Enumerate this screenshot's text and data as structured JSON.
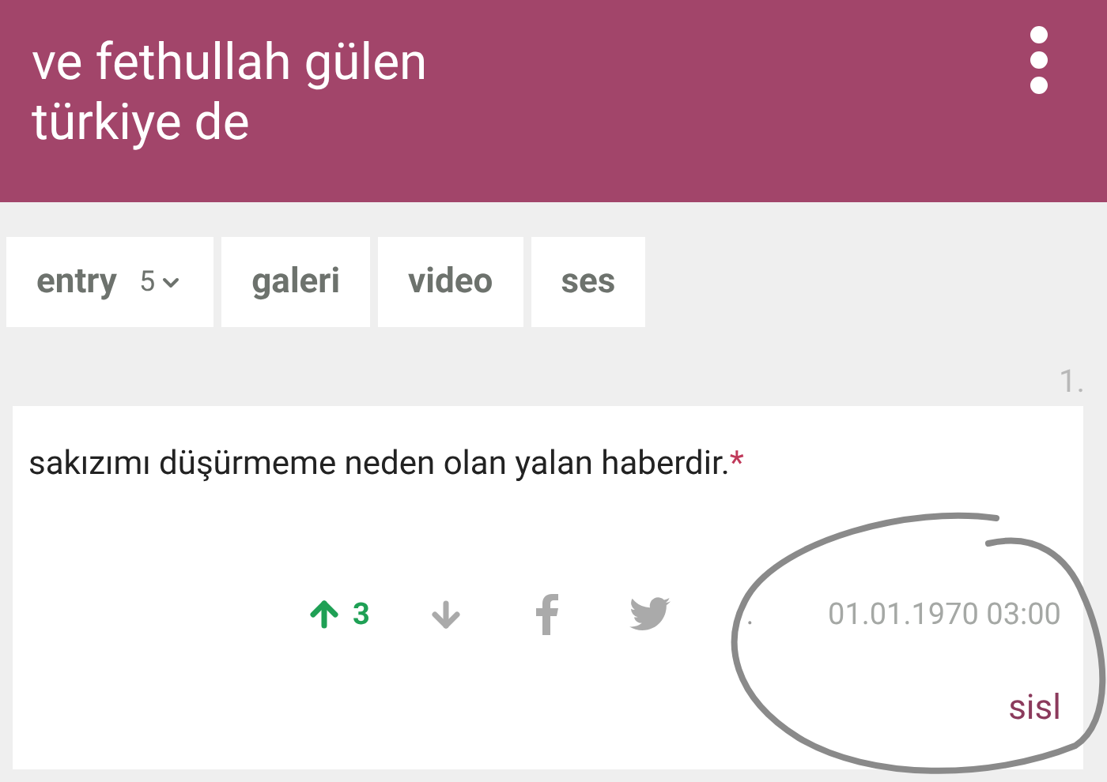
{
  "header": {
    "title": "ve fethullah gülen türkiye de"
  },
  "tabs": [
    {
      "label": "entry",
      "count": "5",
      "selected": false
    },
    {
      "label": "galeri",
      "selected": false
    },
    {
      "label": "video",
      "selected": false
    },
    {
      "label": "ses",
      "selected": false
    }
  ],
  "entry": {
    "index": "1.",
    "text": "sakızımı düşürmeme neden olan yalan haberdir.",
    "mark": "*",
    "upvotes": "3",
    "upvoted": true,
    "separator": ".",
    "date": "01.01.1970 03:00",
    "author": "sisl"
  }
}
